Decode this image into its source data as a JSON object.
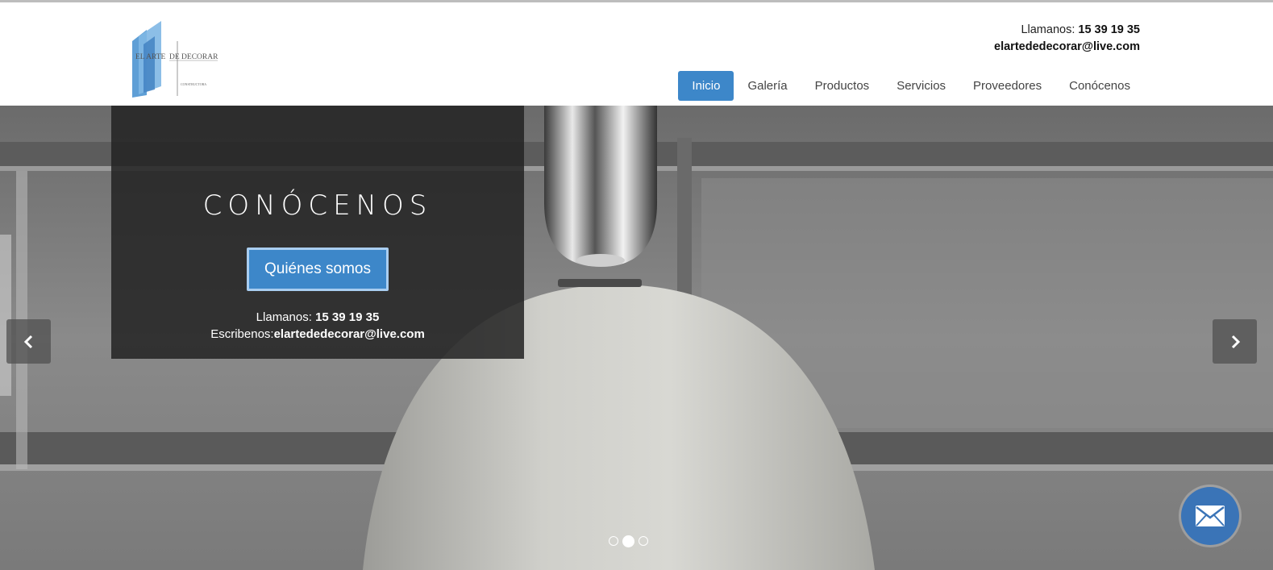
{
  "brand": {
    "logo_text_main": "EL ARTE DE DECORAR",
    "logo_text_sub": "CONSTRUCTORA"
  },
  "header_contact": {
    "phone_label": "Llamanos:",
    "phone": "15 39 19 35",
    "email": "elartededecorar@live.com"
  },
  "nav": {
    "items": [
      {
        "label": "Inicio",
        "active": true
      },
      {
        "label": "Galería"
      },
      {
        "label": "Productos"
      },
      {
        "label": "Servicios"
      },
      {
        "label": "Proveedores"
      },
      {
        "label": "Conócenos"
      }
    ],
    "active_color": "#3d87c9"
  },
  "hero": {
    "title": "CONÓCENOS",
    "button_label": "Quiénes somos",
    "phone_label": "Llamanos:",
    "phone": "15 39 19 35",
    "email_label": "Escribenos:",
    "email": "elartededecorar@live.com",
    "slide_count": 3,
    "active_slide": 2
  },
  "controls": {
    "prev_icon": "chevron-left-icon",
    "next_icon": "chevron-right-icon",
    "mail_icon": "envelope-icon"
  }
}
